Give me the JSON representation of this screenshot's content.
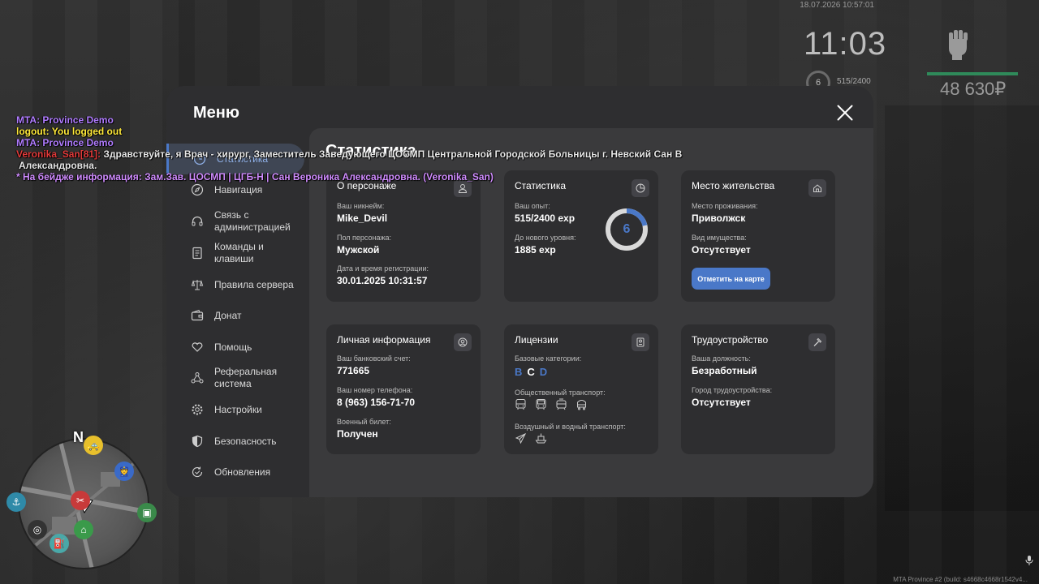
{
  "hud": {
    "datetime": "18.07.2026 10:57:01",
    "clock": "11:03",
    "level": "6",
    "exp": "515/2400",
    "money": "48 630₽",
    "build": "MTA Province #2 (build: s4668c4668r1542v4..."
  },
  "chat": [
    {
      "text": "MTA: Province Demo"
    },
    {
      "text": "logout: You logged out"
    },
    {
      "text": "MTA: Province Demo"
    },
    {
      "name": "Veronika_San[81]:",
      "text": " Здравствуйте, я Врач - хирург, Заместитель Заведующего ЦОСМП Центральной Городской Больницы г. Невский Сан В"
    },
    {
      "text": "Александровна."
    },
    {
      "text": "* На бейдже информация: Зам.Зав. ЦОСМП | ЦГБ-Н | Сан Вероника Александровна. (Veronika_San)"
    }
  ],
  "menu": {
    "title": "Меню",
    "page_title": "Статистика",
    "nav": [
      {
        "label": "Статистика",
        "icon": "clock-icon",
        "active": true
      },
      {
        "label": "Навигация",
        "icon": "compass-icon"
      },
      {
        "label": "Связь с администрацией",
        "icon": "headset-icon"
      },
      {
        "label": "Команды и клавиши",
        "icon": "document-icon"
      },
      {
        "label": "Правила сервера",
        "icon": "scales-icon"
      },
      {
        "label": "Донат",
        "icon": "wallet-icon"
      },
      {
        "label": "Помощь",
        "icon": "heart-hand-icon"
      },
      {
        "label": "Реферальная система",
        "icon": "network-icon"
      },
      {
        "label": "Настройки",
        "icon": "gear-icon"
      },
      {
        "label": "Безопасность",
        "icon": "shield-icon"
      },
      {
        "label": "Обновления",
        "icon": "refresh-icon"
      }
    ]
  },
  "cards": {
    "character": {
      "title": "О персонаже",
      "nickname_label": "Ваш никнейм:",
      "nickname": "Mike_Devil",
      "gender_label": "Пол персонажа:",
      "gender": "Мужской",
      "reg_label": "Дата и время регистрации:",
      "reg": "30.01.2025 10:31:57"
    },
    "stats": {
      "title": "Статистика",
      "exp_label": "Ваш опыт:",
      "exp": "515/2400 exp",
      "next_label": "До нового уровня:",
      "next": "1885 exp",
      "level": "6",
      "progress": 0.2146
    },
    "residence": {
      "title": "Место жительства",
      "place_label": "Место проживания:",
      "place": "Приволжск",
      "property_label": "Вид имущества:",
      "property": "Отсутствует",
      "map_button": "Отметить на карте"
    },
    "personal": {
      "title": "Личная информация",
      "bank_label": "Ваш банковский счет:",
      "bank": "771665",
      "phone_label": "Ваш номер телефона:",
      "phone": "8 (963) 156-71-70",
      "military_label": "Военный билет:",
      "military": "Получен"
    },
    "licenses": {
      "title": "Лицензии",
      "base_label": "Базовые категории:",
      "cat_b": "B",
      "cat_c": "C",
      "cat_d": "D",
      "public_label": "Общественный транспорт:",
      "air_label": "Воздушный и водный транспорт:"
    },
    "employment": {
      "title": "Трудоустройство",
      "position_label": "Ваша должность:",
      "position": "Безработный",
      "city_label": "Город трудоустройства:",
      "city": "Отсутствует"
    }
  },
  "colors": {
    "accent": "#4a78c8",
    "panel": "#2e2e30",
    "content": "#3a3a3c"
  }
}
